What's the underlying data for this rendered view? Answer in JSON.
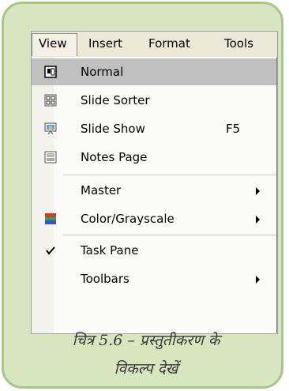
{
  "menubar": {
    "items": [
      "View",
      "Insert",
      "Format",
      "Tools"
    ]
  },
  "menu": {
    "items": [
      {
        "label": "Normal",
        "shortcut": "",
        "submenu": false,
        "icon": "normal-view-icon"
      },
      {
        "label": "Slide Sorter",
        "shortcut": "",
        "submenu": false,
        "icon": "slide-sorter-icon"
      },
      {
        "label": "Slide Show",
        "shortcut": "F5",
        "submenu": false,
        "icon": "slide-show-icon"
      },
      {
        "label": "Notes Page",
        "shortcut": "",
        "submenu": false,
        "icon": "notes-page-icon"
      },
      {
        "label": "Master",
        "shortcut": "",
        "submenu": true,
        "icon": ""
      },
      {
        "label": "Color/Grayscale",
        "shortcut": "",
        "submenu": true,
        "icon": "color-grayscale-icon"
      },
      {
        "label": "Task Pane",
        "shortcut": "",
        "submenu": false,
        "icon": "checkmark-icon"
      },
      {
        "label": "Toolbars",
        "shortcut": "",
        "submenu": true,
        "icon": ""
      }
    ]
  },
  "caption": {
    "line1": "चित्र 5.6 – प्रस्तुतीकरण के",
    "line2": "विकल्प देखें"
  },
  "colors": {
    "card_bg": "#d7e6bf",
    "card_border": "#a9c68a",
    "highlight": "#c0c0c0"
  }
}
